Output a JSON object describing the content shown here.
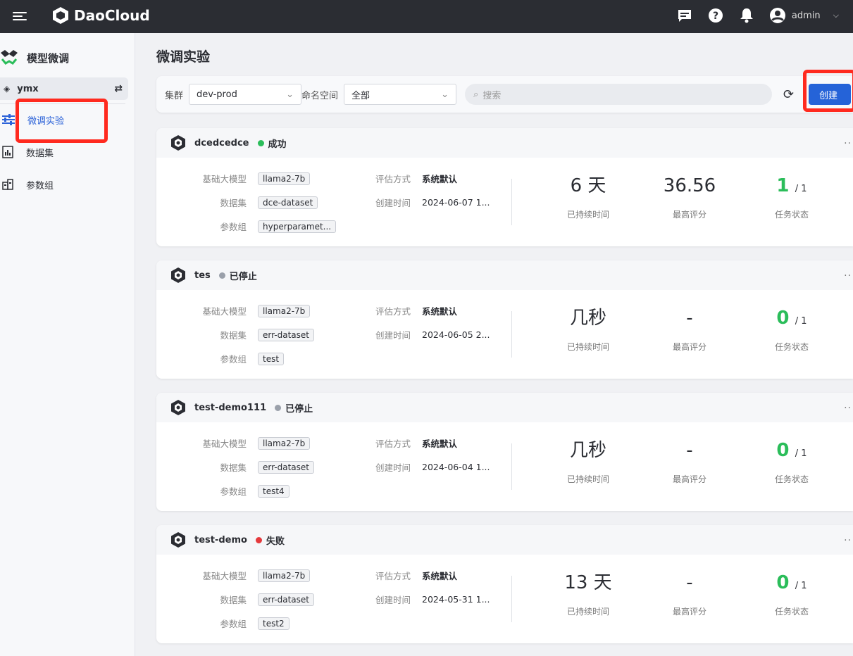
{
  "topbar": {
    "brand": "DaoCloud",
    "user": "admin",
    "icons": [
      "menu-icon",
      "message-icon",
      "help-icon",
      "bell-icon",
      "user-avatar-icon",
      "chevron-down-icon"
    ]
  },
  "sidebar": {
    "app_title": "模型微调",
    "workspace": "ymx",
    "items": [
      {
        "label": "微调实验",
        "icon": "sliders-icon",
        "active": true
      },
      {
        "label": "数据集",
        "icon": "chart-icon"
      },
      {
        "label": "参数组",
        "icon": "param-icon"
      }
    ]
  },
  "page": {
    "title": "微调实验"
  },
  "filter": {
    "cluster_label": "集群",
    "cluster_value": "dev-prod",
    "namespace_label": "命名空间",
    "namespace_value": "全部",
    "search_placeholder": "搜索",
    "create_label": "创建"
  },
  "labels": {
    "base_model": "基础大模型",
    "dataset": "数据集",
    "param_group": "参数组",
    "eval_method": "评估方式",
    "created": "创建时间",
    "duration": "已持续时间",
    "best_score": "最高评分",
    "task_status": "任务状态"
  },
  "colors": {
    "success": "#2bbd5a",
    "stopped": "#9aa0aa",
    "failed": "#e5393c",
    "primary": "#2563d8",
    "annotation": "#ff2a1f"
  },
  "experiments": [
    {
      "name": "dcedcedce",
      "status": "成功",
      "status_color": "#2bbd5a",
      "base_model": "llama2-7b",
      "dataset": "dce-dataset",
      "param_group": "hyperparamet...",
      "eval_method": "系统默认",
      "created": "2024-06-07 1...",
      "duration": "6 天",
      "best_score": "36.56",
      "done": "1",
      "total": "/ 1"
    },
    {
      "name": "tes",
      "status": "已停止",
      "status_color": "#9aa0aa",
      "base_model": "llama2-7b",
      "dataset": "err-dataset",
      "param_group": "test",
      "eval_method": "系统默认",
      "created": "2024-06-05 2...",
      "duration": "几秒",
      "best_score": "-",
      "done": "0",
      "total": "/ 1"
    },
    {
      "name": "test-demo111",
      "status": "已停止",
      "status_color": "#9aa0aa",
      "base_model": "llama2-7b",
      "dataset": "err-dataset",
      "param_group": "test4",
      "eval_method": "系统默认",
      "created": "2024-06-04 1...",
      "duration": "几秒",
      "best_score": "-",
      "done": "0",
      "total": "/ 1"
    },
    {
      "name": "test-demo",
      "status": "失败",
      "status_color": "#e5393c",
      "base_model": "llama2-7b",
      "dataset": "err-dataset",
      "param_group": "test2",
      "eval_method": "系统默认",
      "created": "2024-05-31 1...",
      "duration": "13 天",
      "best_score": "-",
      "done": "0",
      "total": "/ 1"
    }
  ]
}
